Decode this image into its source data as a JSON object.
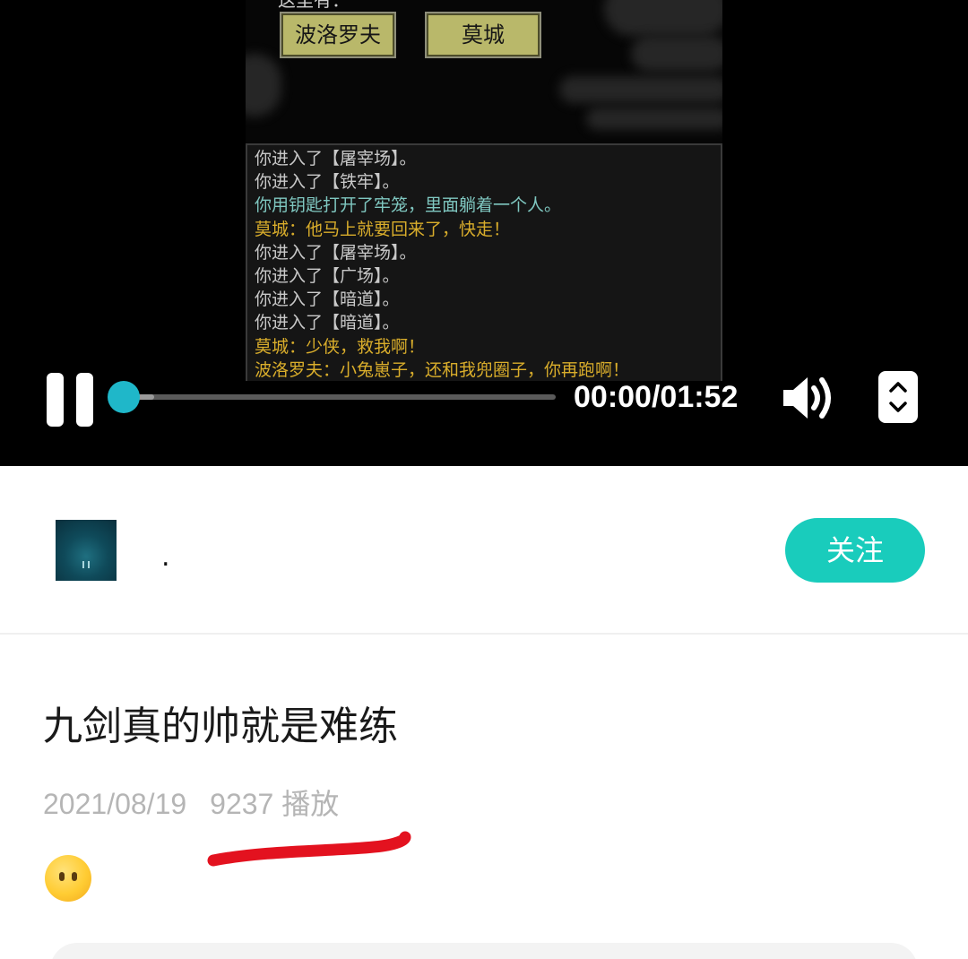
{
  "player": {
    "game": {
      "cut_text": "这里有：",
      "buttons": [
        "波洛罗夫",
        "莫城"
      ],
      "log": [
        {
          "text": "你进入了【屠宰场】。",
          "color": "#c9c9c9"
        },
        {
          "text": "你进入了【铁牢】。",
          "color": "#c9c9c9"
        },
        {
          "text": "你用钥匙打开了牢笼，里面躺着一个人。",
          "color": "#7fc7c0"
        },
        {
          "text": "莫城：他马上就要回来了，快走！",
          "color": "#d9ad2b"
        },
        {
          "text": "你进入了【屠宰场】。",
          "color": "#c9c9c9"
        },
        {
          "text": "你进入了【广场】。",
          "color": "#c9c9c9"
        },
        {
          "text": "你进入了【暗道】。",
          "color": "#c9c9c9"
        },
        {
          "text": "你进入了【暗道】。",
          "color": "#c9c9c9"
        },
        {
          "text": "莫城：少侠，救我啊！",
          "color": "#d9ad2b"
        },
        {
          "text": "波洛罗夫：小兔崽子，还和我兜圈子，你再跑啊！",
          "color": "#d9ad2b"
        }
      ]
    },
    "time": "00:00/01:52",
    "progress": 0.07,
    "accent_color": "#1fb7c9",
    "icons": [
      "pause-icon",
      "volume-icon",
      "fullscreen-icon"
    ]
  },
  "author": {
    "name": ".",
    "follow_label": "关注",
    "follow_color": "#19ccbc"
  },
  "video": {
    "title": "九剑真的帅就是难练",
    "date": "2021/08/19",
    "plays": "9237 播放",
    "emoji": "😶"
  },
  "annotation_color": "#e3121f"
}
